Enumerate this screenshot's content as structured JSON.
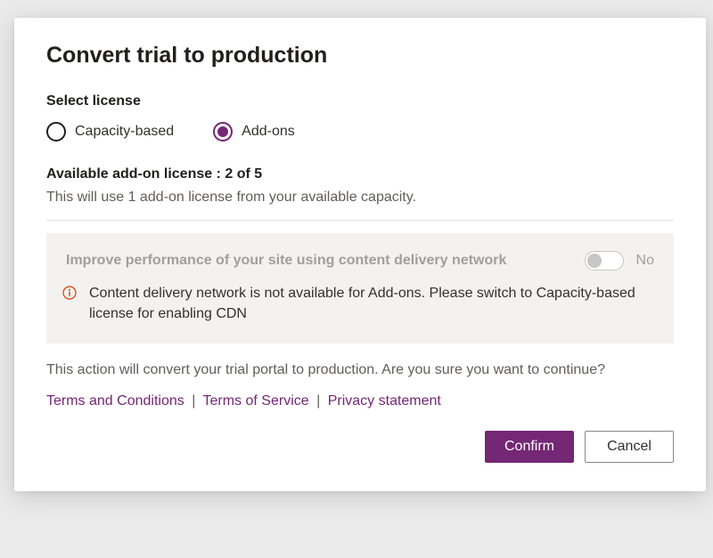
{
  "dialog": {
    "title": "Convert trial to production",
    "selectLicenseLabel": "Select license",
    "radios": {
      "capacity": "Capacity-based",
      "addons": "Add-ons"
    },
    "availability": {
      "title": "Available add-on license : 2 of 5",
      "desc": "This will use 1 add-on license from your available capacity."
    },
    "notice": {
      "header": "Improve performance of your site using content delivery network",
      "toggleLabel": "No",
      "body": "Content delivery network is not available for Add-ons. Please switch to Capacity-based license for enabling CDN"
    },
    "confirmText": "This action will convert your trial portal to production. Are you sure you want to continue?",
    "links": {
      "terms": "Terms and Conditions",
      "tos": "Terms of Service",
      "privacy": "Privacy statement",
      "sep": "|"
    },
    "buttons": {
      "confirm": "Confirm",
      "cancel": "Cancel"
    }
  }
}
